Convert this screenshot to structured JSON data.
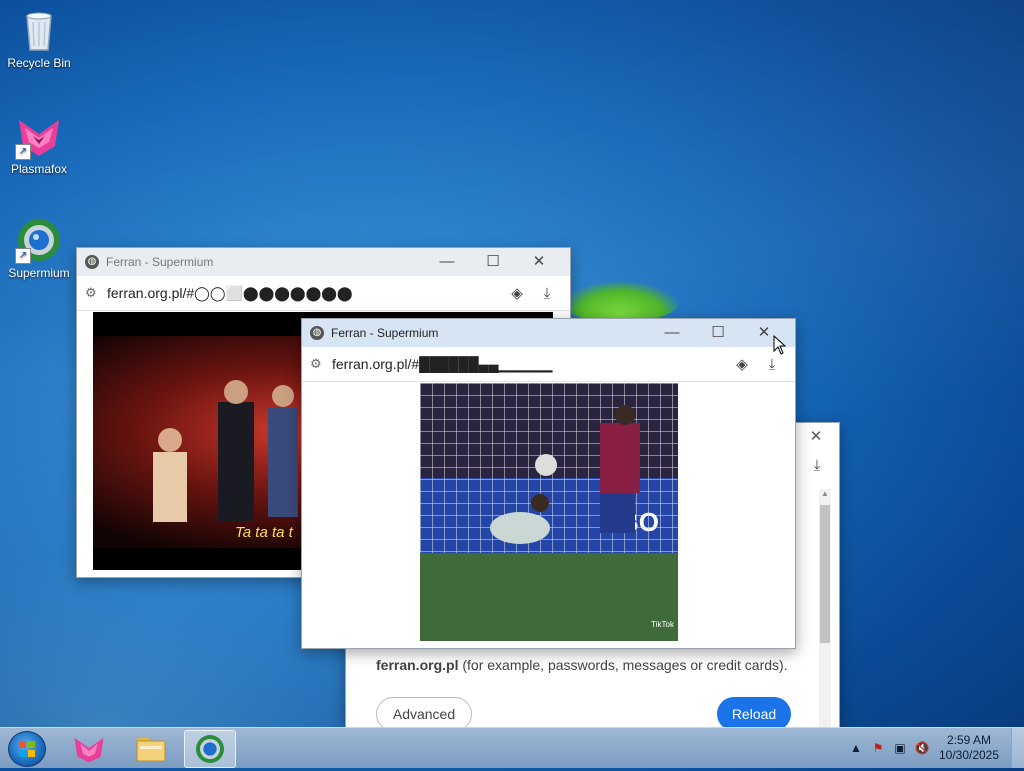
{
  "desktop": {
    "icons": [
      {
        "label": "Recycle Bin",
        "icon": "recycle-bin-icon"
      },
      {
        "label": "Plasmafox",
        "icon": "plasmafox-icon"
      },
      {
        "label": "Supermium",
        "icon": "supermium-icon"
      }
    ]
  },
  "window_back": {
    "title": "Ferran - Supermium",
    "url": "ferran.org.pl/#◯◯⬜⬤⬤⬤⬤⬤⬤⬤",
    "video_caption": "Ta ta ta t"
  },
  "window_front": {
    "title": "Ferran - Supermium",
    "url": "ferran.org.pl/#██████▄▄▁▁▁▁▁",
    "video_watermark": "TikTok"
  },
  "window_error": {
    "warning_host": "ferran.org.pl",
    "warning_text": " (for example, passwords, messages or credit cards).",
    "advanced_label": "Advanced",
    "reload_label": "Reload"
  },
  "taskbar": {
    "time": "2:59 AM",
    "date": "10/30/2025"
  },
  "colors": {
    "reload_blue": "#1a73e8",
    "active_title": "#d7e4f4",
    "inactive_title": "#e9ecf1"
  }
}
